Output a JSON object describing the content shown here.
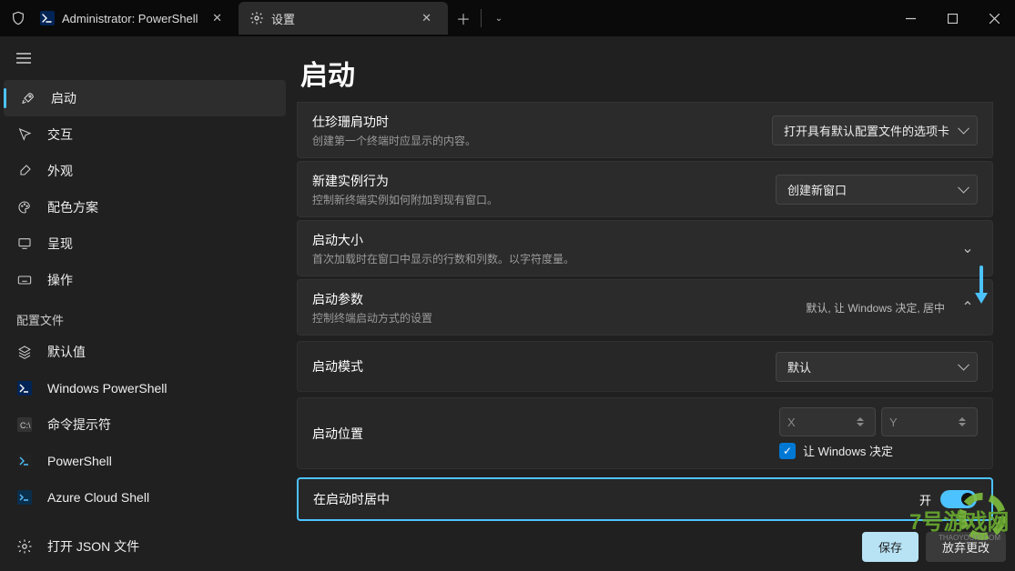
{
  "tabs": {
    "ps": "Administrator: PowerShell",
    "settings": "设置"
  },
  "sidebar": {
    "items": [
      "启动",
      "交互",
      "外观",
      "配色方案",
      "呈现",
      "操作"
    ],
    "profiles_header": "配置文件",
    "profiles": [
      "默认值",
      "Windows PowerShell",
      "命令提示符",
      "PowerShell",
      "Azure Cloud Shell"
    ],
    "open_json": "打开 JSON 文件"
  },
  "page": {
    "title": "启动",
    "c0": {
      "title": "仕珍珊肩功时",
      "sub": "创建第一个终端时应显示的内容。",
      "value": "打开具有默认配置文件的选项卡"
    },
    "c1": {
      "title": "新建实例行为",
      "sub": "控制新终端实例如何附加到现有窗口。",
      "value": "创建新窗口"
    },
    "c2": {
      "title": "启动大小",
      "sub": "首次加载时在窗口中显示的行数和列数。以字符度量。"
    },
    "c3": {
      "title": "启动参数",
      "sub": "控制终端启动方式的设置",
      "summary": "默认, 让 Windows 决定, 居中"
    },
    "mode": {
      "label": "启动模式",
      "value": "默认"
    },
    "pos": {
      "label": "启动位置",
      "x": "X",
      "y": "Y",
      "chk": "让 Windows 决定"
    },
    "center": {
      "label": "在启动时居中",
      "state": "开"
    }
  },
  "footer": {
    "save": "保存",
    "discard": "放弃更改"
  },
  "watermark": "7号游戏网"
}
